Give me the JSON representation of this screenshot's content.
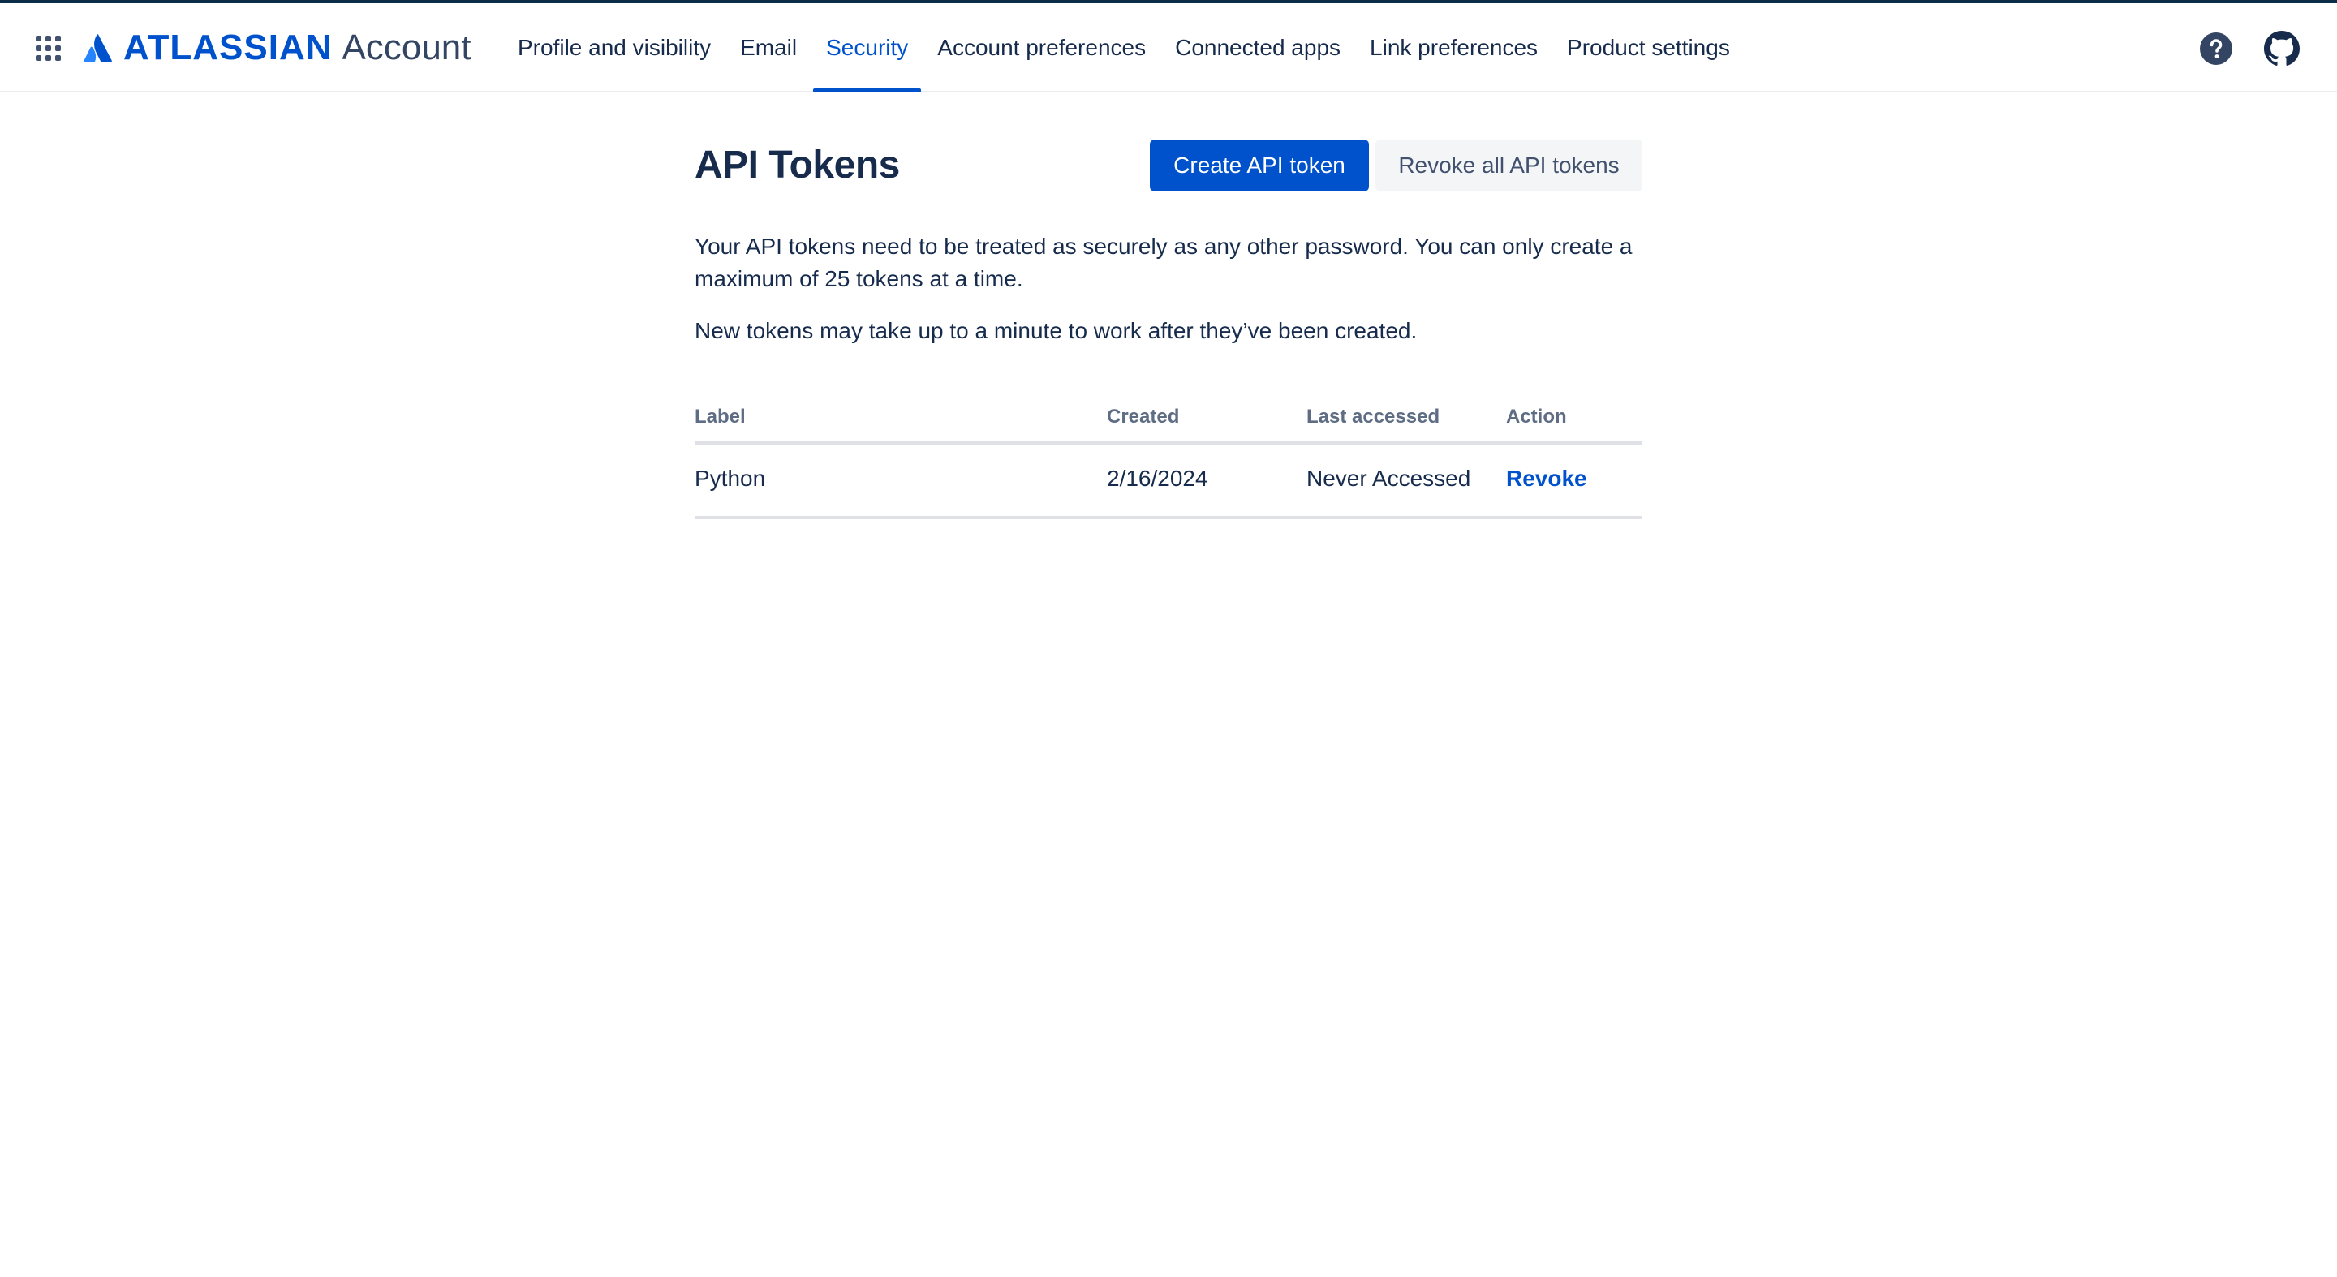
{
  "header": {
    "logo_word": "ATLASSIAN",
    "logo_product": "Account",
    "nav": [
      {
        "label": "Profile and visibility"
      },
      {
        "label": "Email"
      },
      {
        "label": "Security",
        "active": true
      },
      {
        "label": "Account preferences"
      },
      {
        "label": "Connected apps"
      },
      {
        "label": "Link preferences"
      },
      {
        "label": "Product settings"
      }
    ],
    "icons": [
      "app-switcher-icon",
      "help-icon",
      "github-icon"
    ]
  },
  "page": {
    "title": "API Tokens",
    "create_button": "Create API token",
    "revoke_all_button": "Revoke all API tokens",
    "description_1": "Your API tokens need to be treated as securely as any other password. You can only create a maximum of 25 tokens at a time.",
    "description_2": "New tokens may take up to a minute to work after they’ve been created."
  },
  "table": {
    "headers": {
      "label": "Label",
      "created": "Created",
      "last_accessed": "Last accessed",
      "action": "Action"
    },
    "rows": [
      {
        "label": "Python",
        "created": "2/16/2024",
        "last_accessed": "Never Accessed",
        "action": "Revoke"
      }
    ]
  },
  "colors": {
    "brand": "#0052cc",
    "text": "#172b4d",
    "subtle_text": "#5e6c84",
    "border": "#dfe1e6",
    "top_strip": "#0c2d48"
  }
}
